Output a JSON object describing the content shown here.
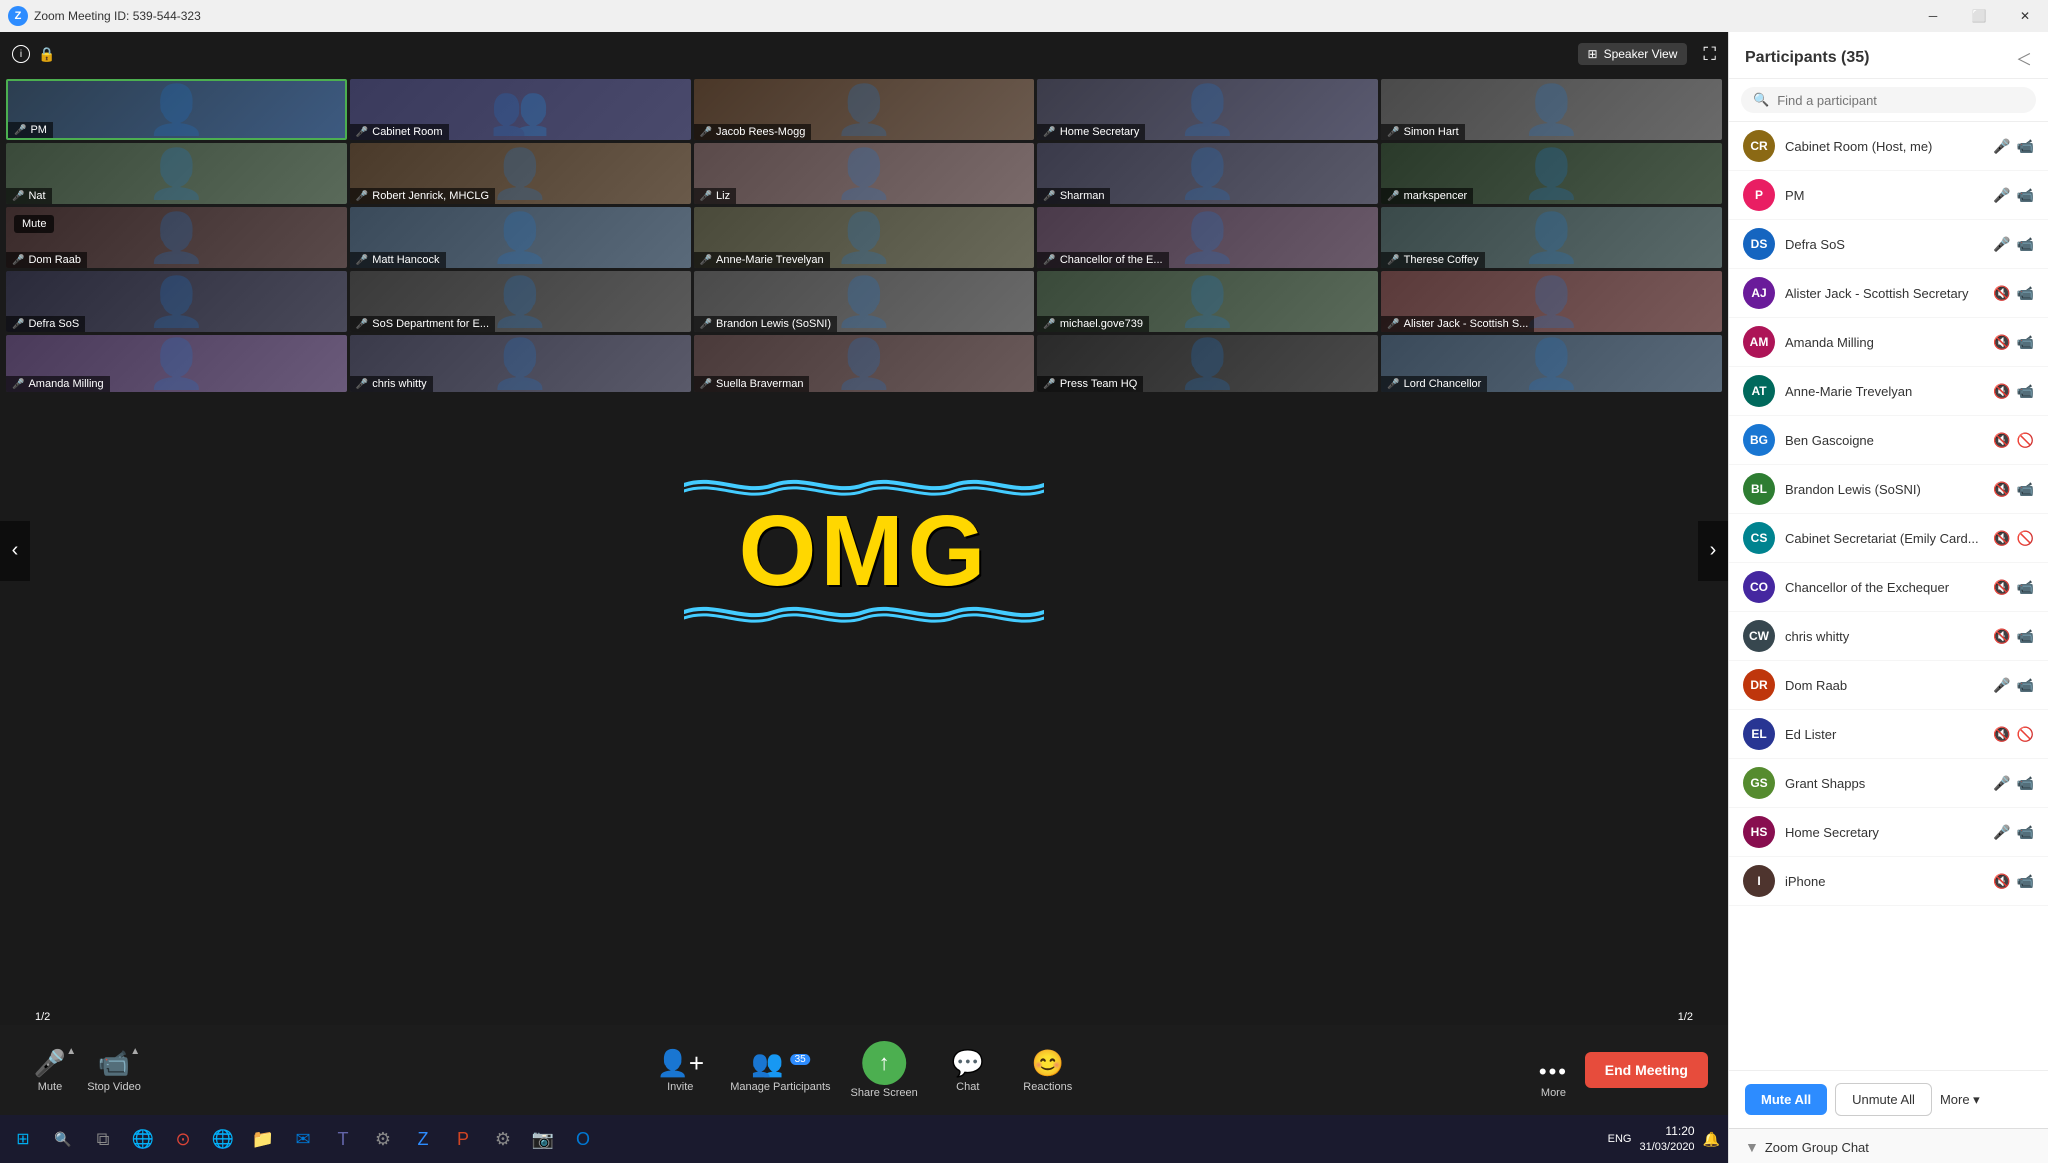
{
  "titlebar": {
    "meeting_id": "Zoom Meeting ID: 539-544-323",
    "minimize": "─",
    "maximize": "⬜",
    "close": "✕"
  },
  "video_area": {
    "speaker_view_label": "Speaker View",
    "page_left": "1/2",
    "page_right": "1/2",
    "tiles": [
      {
        "id": "pm",
        "label": "PM",
        "muted": false,
        "active": true,
        "bg": "tile-bg-pm"
      },
      {
        "id": "cabinet",
        "label": "Cabinet Room",
        "muted": false,
        "active": false,
        "bg": "tile-bg-cabinet"
      },
      {
        "id": "jacob",
        "label": "Jacob Rees-Mogg",
        "muted": true,
        "active": false,
        "bg": "tile-bg-jacob"
      },
      {
        "id": "home",
        "label": "Home Secretary",
        "muted": true,
        "active": false,
        "bg": "tile-bg-home"
      },
      {
        "id": "simon",
        "label": "Simon Hart",
        "muted": false,
        "active": false,
        "bg": "tile-bg-simon"
      },
      {
        "id": "nat",
        "label": "Nat",
        "muted": true,
        "active": false,
        "bg": "tile-bg-nat"
      },
      {
        "id": "robert",
        "label": "Robert Jenrick, MHCLG",
        "muted": true,
        "active": false,
        "bg": "tile-bg-robert"
      },
      {
        "id": "liz",
        "label": "Liz",
        "muted": false,
        "active": false,
        "bg": "tile-bg-liz"
      },
      {
        "id": "sharma",
        "label": "Sharman",
        "muted": false,
        "active": false,
        "bg": "tile-bg-sharma"
      },
      {
        "id": "mark",
        "label": "markspencer",
        "muted": false,
        "active": false,
        "bg": "tile-bg-mark"
      },
      {
        "id": "dom",
        "label": "Dom Raab",
        "muted": true,
        "active": false,
        "bg": "tile-bg-dom"
      },
      {
        "id": "matt",
        "label": "Matt Hancock",
        "muted": true,
        "active": false,
        "bg": "tile-bg-matt"
      },
      {
        "id": "annemarie",
        "label": "Anne-Marie Trevelyan",
        "muted": true,
        "active": false,
        "bg": "tile-bg-annemarie"
      },
      {
        "id": "chancellor",
        "label": "Chancellor of the E...",
        "muted": false,
        "active": false,
        "bg": "tile-bg-chancellor"
      },
      {
        "id": "therese",
        "label": "Therese Coffey",
        "muted": true,
        "active": false,
        "bg": "tile-bg-therese"
      },
      {
        "id": "defra",
        "label": "Defra SoS",
        "muted": false,
        "active": false,
        "bg": "tile-bg-defra"
      },
      {
        "id": "sos",
        "label": "SoS Department for E...",
        "muted": true,
        "active": false,
        "bg": "tile-bg-sos"
      },
      {
        "id": "brandon",
        "label": "Brandon Lewis (SoSNI)",
        "muted": true,
        "active": false,
        "bg": "tile-bg-brandon"
      },
      {
        "id": "michael",
        "label": "michael.gove739",
        "muted": false,
        "active": false,
        "bg": "tile-bg-michael"
      },
      {
        "id": "alister",
        "label": "Alister Jack - Scottish S...",
        "muted": false,
        "active": false,
        "bg": "tile-bg-alister"
      },
      {
        "id": "amanda",
        "label": "Amanda Milling",
        "muted": true,
        "active": false,
        "bg": "tile-bg-amanda"
      },
      {
        "id": "chris",
        "label": "chris whitty",
        "muted": true,
        "active": false,
        "bg": "tile-bg-chris"
      },
      {
        "id": "suella",
        "label": "Suella Braverman",
        "muted": false,
        "active": false,
        "bg": "tile-bg-suella"
      },
      {
        "id": "press",
        "label": "Press Team HQ",
        "muted": false,
        "active": false,
        "bg": "tile-bg-press"
      },
      {
        "id": "lord",
        "label": "Lord Chancellor",
        "muted": true,
        "active": false,
        "bg": "tile-bg-lord"
      }
    ],
    "mute_tooltip": "Mute",
    "omg_text": "OMG"
  },
  "toolbar": {
    "mute_label": "Mute",
    "video_label": "Stop Video",
    "invite_label": "Invite",
    "participants_label": "Manage Participants",
    "participants_count": "35",
    "share_screen_label": "Share Screen",
    "chat_label": "Chat",
    "reactions_label": "Reactions",
    "more_label": "More",
    "end_meeting_label": "End Meeting"
  },
  "participants": {
    "title": "Participants (35)",
    "count": 35,
    "search_placeholder": "Find a participant",
    "items": [
      {
        "initials": "CR",
        "name": "Cabinet Room (Host, me)",
        "color": "#8B6914",
        "muted": false,
        "video": true
      },
      {
        "initials": "P",
        "name": "PM",
        "color": "#E91E63",
        "muted": false,
        "video": true
      },
      {
        "initials": "DS",
        "name": "Defra SoS",
        "color": "#1565C0",
        "muted": false,
        "video": true
      },
      {
        "initials": "AJ",
        "name": "Alister Jack - Scottish Secretary",
        "color": "#6A1B9A",
        "muted": true,
        "video": true
      },
      {
        "initials": "AM",
        "name": "Amanda Milling",
        "color": "#AD1457",
        "muted": true,
        "video": true
      },
      {
        "initials": "AT",
        "name": "Anne-Marie Trevelyan",
        "color": "#00695C",
        "muted": true,
        "video": true
      },
      {
        "initials": "BG",
        "name": "Ben Gascoigne",
        "color": "#1976D2",
        "muted": true,
        "video": false
      },
      {
        "initials": "BL",
        "name": "Brandon Lewis (SoSNI)",
        "color": "#2E7D32",
        "muted": true,
        "video": true
      },
      {
        "initials": "CS",
        "name": "Cabinet Secretariat (Emily Card...",
        "color": "#00838F",
        "muted": true,
        "video": false
      },
      {
        "initials": "CO",
        "name": "Chancellor of the Exchequer",
        "color": "#4527A0",
        "muted": true,
        "video": true
      },
      {
        "initials": "CW",
        "name": "chris whitty",
        "color": "#37474F",
        "muted": true,
        "video": true
      },
      {
        "initials": "DR",
        "name": "Dom Raab",
        "color": "#BF360C",
        "muted": false,
        "video": true
      },
      {
        "initials": "EL",
        "name": "Ed Lister",
        "color": "#283593",
        "muted": true,
        "video": false
      },
      {
        "initials": "GS",
        "name": "Grant Shapps",
        "color": "#558B2F",
        "muted": false,
        "video": true
      },
      {
        "initials": "HS",
        "name": "Home Secretary",
        "color": "#880E4F",
        "muted": false,
        "video": true
      },
      {
        "initials": "I",
        "name": "iPhone",
        "color": "#4E342E",
        "muted": true,
        "video": true
      }
    ],
    "mute_all_label": "Mute All",
    "unmute_all_label": "Unmute All",
    "more_label": "More ▾"
  },
  "zoom_chat": {
    "title": "Zoom Group Chat"
  },
  "taskbar": {
    "time": "11:20",
    "date": "31/03/2020",
    "lang": "ENG"
  }
}
